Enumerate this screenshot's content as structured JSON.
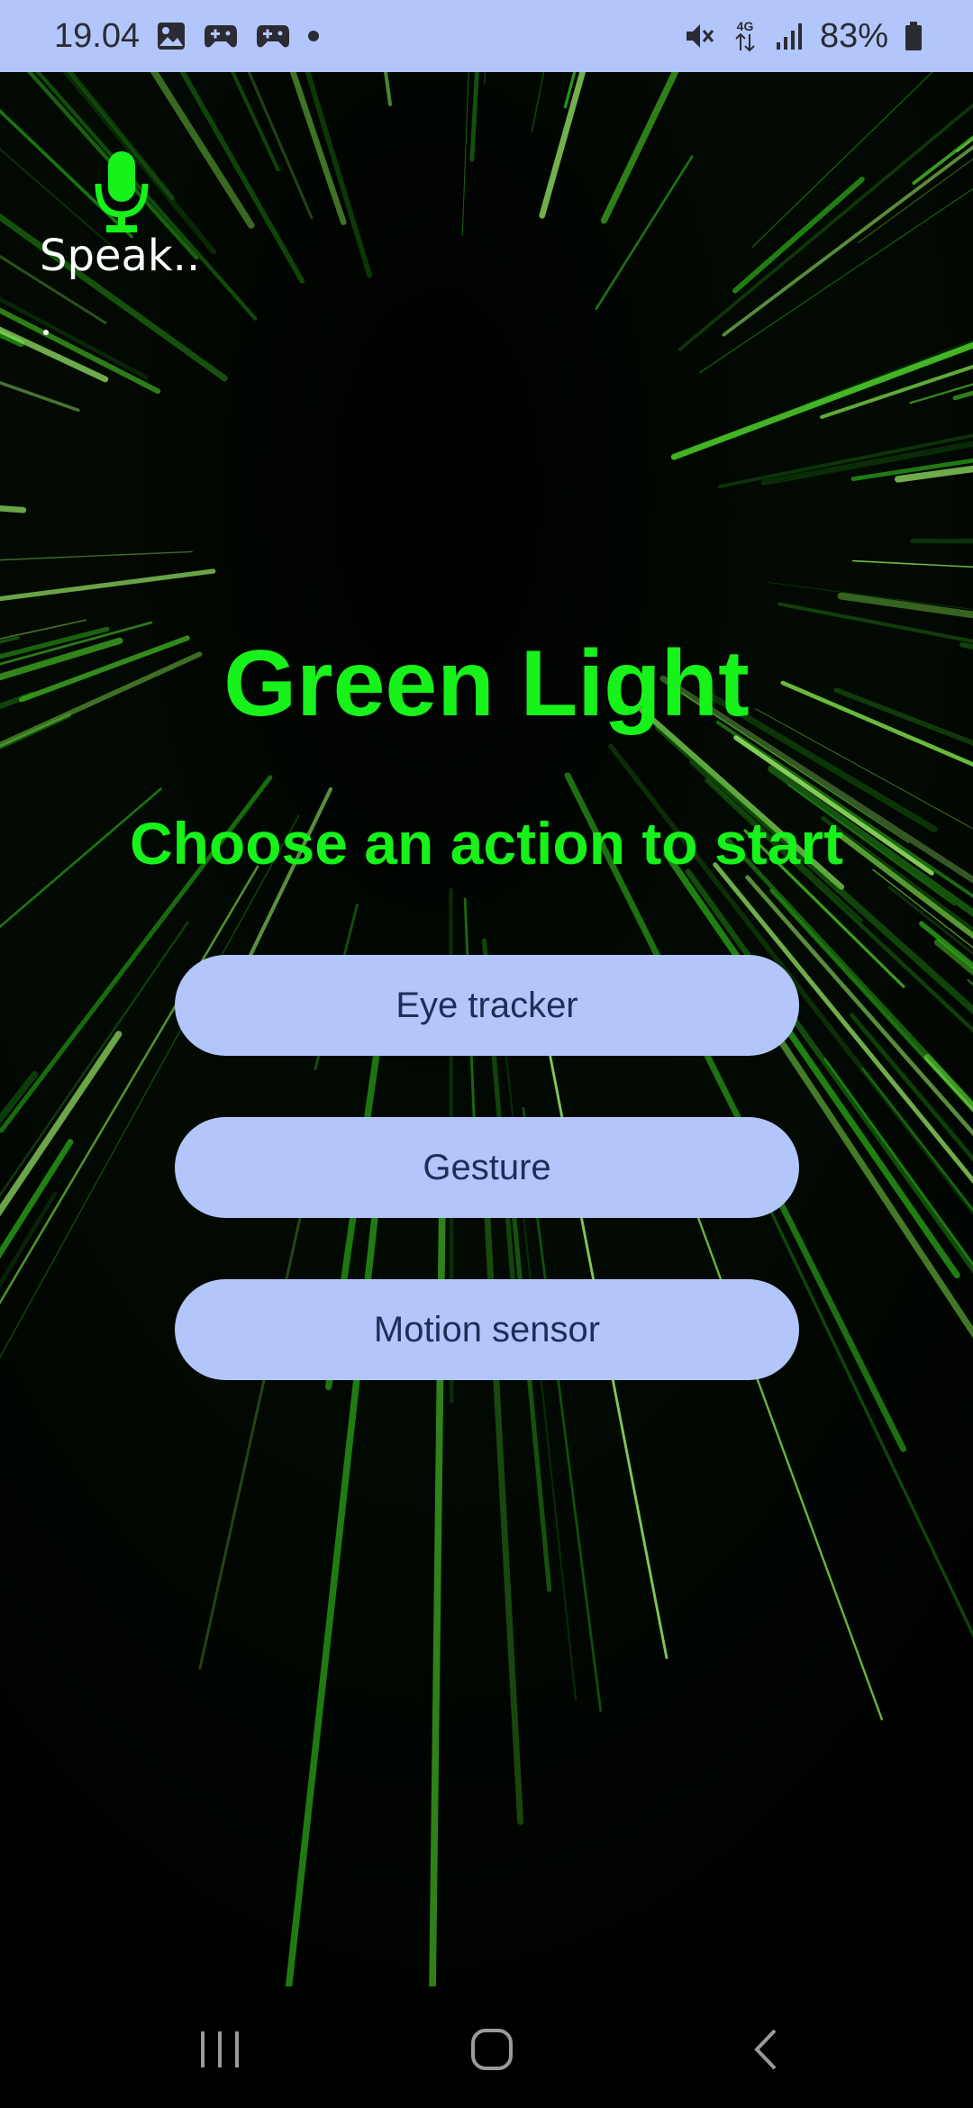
{
  "status_bar": {
    "time": "19.04",
    "battery": "83%",
    "network": "4G",
    "icons_left": [
      "gallery-icon",
      "game-controller-icon",
      "game-controller-icon",
      "dot-icon"
    ],
    "icons_right": [
      "mute-icon",
      "network-4g-icon",
      "signal-icon",
      "battery-icon"
    ]
  },
  "voice": {
    "label": "Speak..",
    "icon": "microphone-icon",
    "transcript": "."
  },
  "main": {
    "title": "Green Light",
    "subtitle": "Choose an action to start",
    "actions": [
      {
        "label": "Eye tracker"
      },
      {
        "label": "Gesture"
      },
      {
        "label": "Motion sensor"
      }
    ]
  },
  "nav_bar": {
    "icons": [
      "recents-icon",
      "home-icon",
      "back-icon"
    ]
  },
  "colors": {
    "accent_green": "#17f21a",
    "button_bg": "#b3c6fb",
    "button_text": "#1c2f5a",
    "status_bar_bg": "#b3c6fb",
    "background": "#000000"
  }
}
